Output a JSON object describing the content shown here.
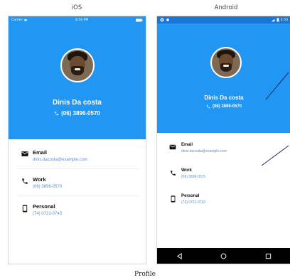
{
  "labels": {
    "ios": "iOS",
    "android": "Android",
    "caption": "Profile"
  },
  "ios": {
    "status": {
      "carrier": "Carrier",
      "time": "8:50 PM"
    },
    "profile": {
      "name": "Dinis Da costa",
      "phone": "(06) 3896-0570"
    },
    "contacts": [
      {
        "icon": "email-icon",
        "label": "Email",
        "value": "dinis.dacosta@example.com"
      },
      {
        "icon": "phone-icon",
        "label": "Work",
        "value": "(06) 3896-0570"
      },
      {
        "icon": "mobile-icon",
        "label": "Personal",
        "value": "(74) 0721-0743"
      }
    ]
  },
  "android": {
    "status": {
      "time": "4:50"
    },
    "profile": {
      "name": "Dinis Da costa",
      "phone": "(06) 3896-0570"
    },
    "contacts": [
      {
        "icon": "email-icon",
        "label": "Email",
        "value": "dinis.dacosta@example.com"
      },
      {
        "icon": "phone-icon",
        "label": "Work",
        "value": "(06) 3896-0570"
      },
      {
        "icon": "mobile-icon",
        "label": "Personal",
        "value": "(74) 0721-0743"
      }
    ]
  },
  "colors": {
    "header": "#2196f3",
    "android_status": "#1976d2",
    "link": "#5a8fd0",
    "nav_bar": "#000000"
  }
}
